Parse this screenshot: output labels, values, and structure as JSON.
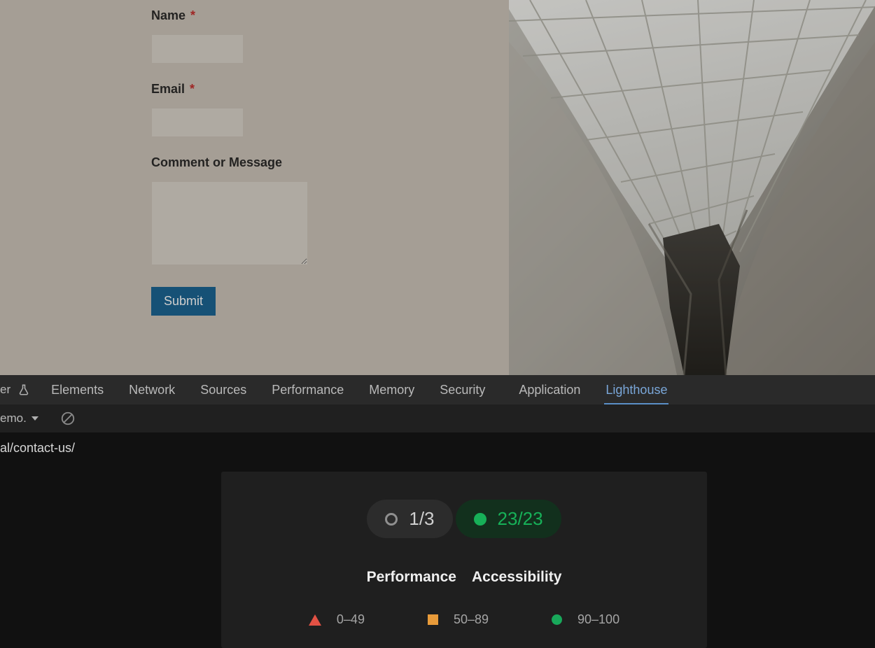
{
  "form": {
    "name_label": "Name",
    "email_label": "Email",
    "comment_label": "Comment or Message",
    "required_mark": "*",
    "submit_label": "Submit"
  },
  "devtools": {
    "trunc_left": "er",
    "tabs": {
      "elements": "Elements",
      "network": "Network",
      "sources": "Sources",
      "performance": "Performance",
      "memory": "Memory",
      "security": "Security",
      "application": "Application",
      "lighthouse": "Lighthouse"
    },
    "subbar": {
      "dropdown_trunc": "emo."
    },
    "url_trunc": "al/contact-us/",
    "lighthouse": {
      "pill1": "1/3",
      "pill2": "23/23",
      "categories": {
        "performance": "Performance",
        "accessibility": "Accessibility"
      },
      "legend": {
        "low": "0–49",
        "mid": "50–89",
        "high": "90–100"
      }
    }
  }
}
